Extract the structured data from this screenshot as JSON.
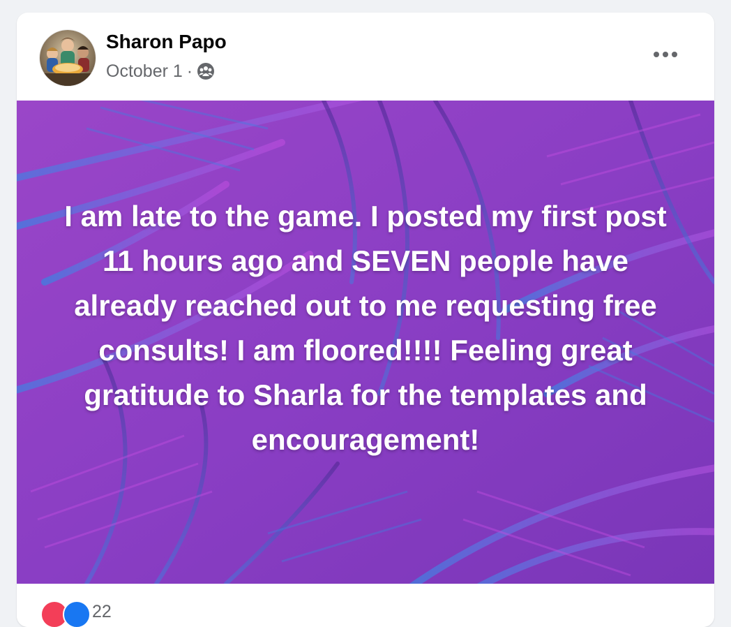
{
  "post": {
    "author": "Sharon Papo",
    "date": "October 1",
    "separator": "·",
    "audience_icon": "group-audience-icon",
    "more_icon": "more-options-icon",
    "text": "I am late to the game. I posted my first post 11 hours ago and SEVEN people have already reached out to me requesting free consults! I am floored!!!! Feeling great gratitude to Sharla for the templates and encouragement!",
    "background_colors": {
      "base": "#8a3ec4",
      "leaf_blue": "#3f7fe0",
      "leaf_violet": "#c04ee0",
      "leaf_dark": "#5a2a9a"
    },
    "text_color": "#ffffff"
  },
  "reactions": {
    "icons": [
      "love-reaction-icon",
      "like-reaction-icon"
    ],
    "count_text": "22"
  },
  "colors": {
    "page_bg": "#f0f2f5",
    "card_bg": "#ffffff",
    "name_color": "#050505",
    "meta_color": "#65676b"
  }
}
